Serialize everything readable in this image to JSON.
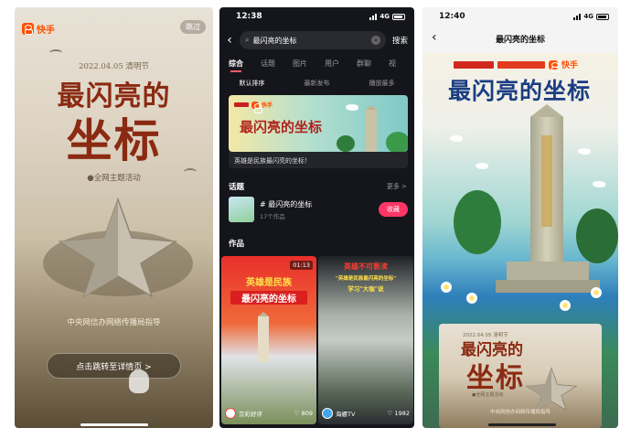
{
  "panel1": {
    "brand": "快手",
    "skip": "跳过",
    "date": "2022.04.05 清明节",
    "title_line1": "最闪亮的",
    "title_line2": "坐标",
    "subtitle": "●全网主题活动",
    "guidance": "中央网信办网络传播局指导",
    "jump_button": "点击跳转至详情页 >"
  },
  "panel2": {
    "time": "12:38",
    "network": "4G",
    "search_query": "最闪亮的坐标",
    "search_button": "搜索",
    "tabs": [
      "综合",
      "话题",
      "图片",
      "用户",
      "群聊",
      "视"
    ],
    "active_tab": "综合",
    "sort_options": [
      "默认排序",
      "最新发布",
      "播放最多"
    ],
    "banner": {
      "brand": "快手",
      "title": "最闪亮的坐标",
      "caption": "英雄是民族最闪亮的坐标！"
    },
    "topics_heading": "话题",
    "more": "更多 >",
    "topic": {
      "name": "# 最闪亮的坐标",
      "count": "17个作品",
      "collect": "收藏"
    },
    "works_heading": "作品",
    "works": [
      {
        "duration": "01:13",
        "label1": "英雄是民族",
        "label2": "最闪亮的坐标",
        "author": "京彩好评",
        "likes": "809"
      },
      {
        "label1": "英雄不可亵渎",
        "label2": "\"英雄是民族最闪亮的坐标\"",
        "label3": "学习\"大咖\"说",
        "author": "海螺TV",
        "likes": "1982"
      }
    ]
  },
  "panel3": {
    "time": "12:40",
    "network": "4G",
    "nav_title": "最闪亮的坐标",
    "logo_text": "快手",
    "poster_title": "最闪亮的坐标",
    "inner": {
      "date": "2022.04.05 清明节",
      "title_line1": "最闪亮的",
      "title_line2": "坐标",
      "subtitle": "●全网主题活动",
      "guidance": "中央网信办网络传播局指导"
    }
  },
  "colors": {
    "kuaishou": "#ff5000",
    "title_red": "#8b2a12",
    "collect_pink": "#fe3666",
    "poster_blue": "#1b3d82"
  }
}
